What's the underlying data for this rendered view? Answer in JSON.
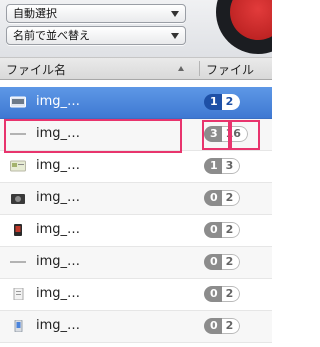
{
  "top": {
    "select_mode": "自動選択",
    "select_sort": "名前で並べ替え"
  },
  "header": {
    "col_name": "ファイル名",
    "col_files": "ファイル"
  },
  "rows": [
    {
      "name": "img_…",
      "icon": "display-icon",
      "count_a": "1",
      "count_b": "2",
      "selected": true
    },
    {
      "name": "img_…",
      "icon": "dash-icon",
      "count_a": "3",
      "count_b": "16",
      "selected": false
    },
    {
      "name": "img_…",
      "icon": "card-icon",
      "count_a": "1",
      "count_b": "3",
      "selected": false
    },
    {
      "name": "img_…",
      "icon": "camera-icon",
      "count_a": "0",
      "count_b": "2",
      "selected": false
    },
    {
      "name": "img_…",
      "icon": "phone-dark-icon",
      "count_a": "0",
      "count_b": "2",
      "selected": false
    },
    {
      "name": "img_…",
      "icon": "dash-icon",
      "count_a": "0",
      "count_b": "2",
      "selected": false
    },
    {
      "name": "img_…",
      "icon": "document-icon",
      "count_a": "0",
      "count_b": "2",
      "selected": false
    },
    {
      "name": "img_…",
      "icon": "phone-light-icon",
      "count_a": "0",
      "count_b": "2",
      "selected": false
    }
  ],
  "colors": {
    "selection_blue": "#4a84dc",
    "highlight_pink": "#e8346d"
  }
}
